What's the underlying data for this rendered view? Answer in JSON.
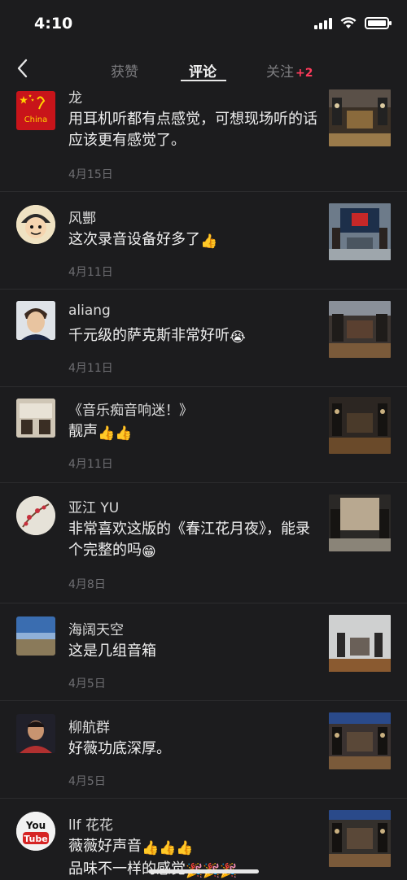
{
  "status": {
    "time": "4:10"
  },
  "nav": {
    "tabs": [
      {
        "label": "获赞"
      },
      {
        "label": "评论"
      },
      {
        "label": "关注"
      }
    ],
    "follow_badge": "+2"
  },
  "comments": [
    {
      "user": "龙",
      "text": "用耳机听都有点感觉，可想现场听的话应该更有感觉了。",
      "date": "4月15日",
      "avatar_text": "China"
    },
    {
      "user": "风酆",
      "text": "这次录音设备好多了",
      "emoji": "👍",
      "date": "4月11日"
    },
    {
      "user": "aliang",
      "text": "千元级的萨克斯非常好听",
      "emoji": "😭",
      "date": "4月11日"
    },
    {
      "user": "《音乐痴音响迷！》",
      "text": "靓声",
      "emoji": "👍👍",
      "date": "4月11日"
    },
    {
      "user": "亚江 YU",
      "text": "非常喜欢这版的《春江花月夜》，能录个完整的吗",
      "emoji": "😁",
      "date": "4月8日"
    },
    {
      "user": "海阔天空",
      "text": "这是几组音箱",
      "date": "4月5日"
    },
    {
      "user": "柳航群",
      "text": "好薇功底深厚。",
      "date": "4月5日"
    },
    {
      "user": "llf 花花",
      "text": "薇薇好声音",
      "emoji": "👍👍👍",
      "text2": "品味不一样的感觉",
      "emoji2": "🎉🎉🎉",
      "date": "",
      "avatar_text_1": "You",
      "avatar_text_2": "Tube"
    }
  ],
  "colors": {
    "background": "#1c1c1e",
    "badge": "#ff3b5c",
    "date": "#6e6e72"
  },
  "icons": {
    "back": "chevron-left-icon",
    "signal": "signal-icon",
    "wifi": "wifi-icon",
    "battery": "battery-icon"
  }
}
